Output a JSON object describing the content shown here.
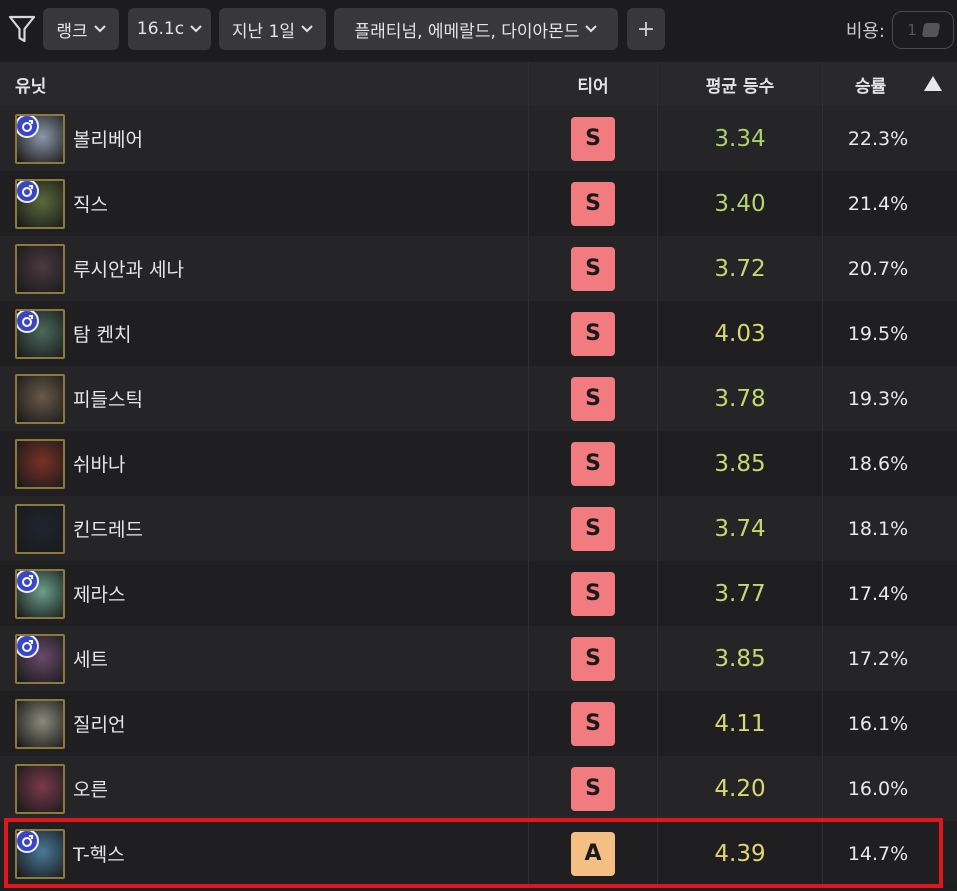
{
  "filters": {
    "rank_label": "랭크",
    "patch_label": "16.1c",
    "period_label": "지난 1일",
    "tiers_label": "플래티넘, 에메랄드, 다이아몬드",
    "add_label": "+"
  },
  "cost": {
    "label": "비용:",
    "value": "1"
  },
  "table": {
    "headers": {
      "unit": "유닛",
      "tier": "티어",
      "avg": "평균 등수",
      "win": "승률"
    },
    "rows": [
      {
        "name": "볼리베어",
        "tier": "S",
        "avg": "3.34",
        "win": "22.3%",
        "avg_color": "#a8d36a",
        "portrait": "#8c98a8",
        "badge": true
      },
      {
        "name": "직스",
        "tier": "S",
        "avg": "3.40",
        "win": "21.4%",
        "avg_color": "#b4d46c",
        "portrait": "#5a6a3a",
        "badge": true
      },
      {
        "name": "루시안과 세나",
        "tier": "S",
        "avg": "3.72",
        "win": "20.7%",
        "avg_color": "#c4d870",
        "portrait": "#4a3a3e",
        "badge": false
      },
      {
        "name": "탐 켄치",
        "tier": "S",
        "avg": "4.03",
        "win": "19.5%",
        "avg_color": "#d6d872",
        "portrait": "#4a6a5a",
        "badge": true
      },
      {
        "name": "피들스틱",
        "tier": "S",
        "avg": "3.78",
        "win": "19.3%",
        "avg_color": "#c4d870",
        "portrait": "#6a5a48",
        "badge": false
      },
      {
        "name": "쉬바나",
        "tier": "S",
        "avg": "3.85",
        "win": "18.6%",
        "avg_color": "#c8d870",
        "portrait": "#7a3224",
        "badge": false
      },
      {
        "name": "킨드레드",
        "tier": "S",
        "avg": "3.74",
        "win": "18.1%",
        "avg_color": "#c4d870",
        "portrait": "#1e2430",
        "badge": false
      },
      {
        "name": "제라스",
        "tier": "S",
        "avg": "3.77",
        "win": "17.4%",
        "avg_color": "#c4d870",
        "portrait": "#6aa08a",
        "badge": true
      },
      {
        "name": "세트",
        "tier": "S",
        "avg": "3.85",
        "win": "17.2%",
        "avg_color": "#c8d870",
        "portrait": "#6a4a6a",
        "badge": true
      },
      {
        "name": "질리언",
        "tier": "S",
        "avg": "4.11",
        "win": "16.1%",
        "avg_color": "#d8d872",
        "portrait": "#8a8a7a",
        "badge": false
      },
      {
        "name": "오른",
        "tier": "S",
        "avg": "4.20",
        "win": "16.0%",
        "avg_color": "#dcd870",
        "portrait": "#7a3a4a",
        "badge": false
      },
      {
        "name": "T-헥스",
        "tier": "A",
        "avg": "4.39",
        "win": "14.7%",
        "avg_color": "#e4d470",
        "portrait": "#4a7a9a",
        "badge": true
      }
    ]
  }
}
